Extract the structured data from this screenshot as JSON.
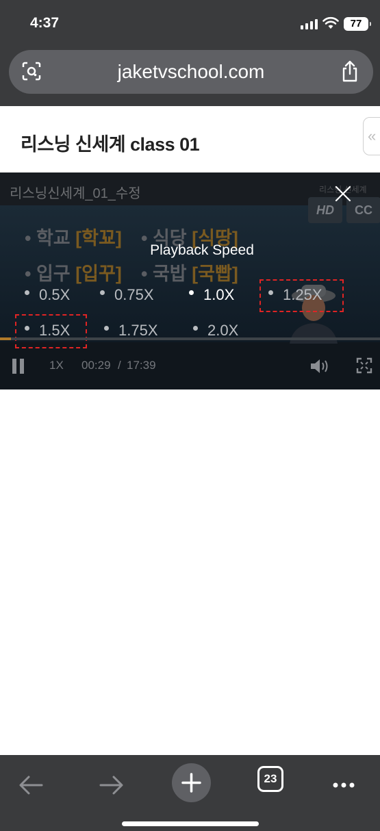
{
  "status_bar": {
    "time": "4:37",
    "battery": "77"
  },
  "browser": {
    "url": "jaketvschool.com",
    "tab_count": "23"
  },
  "page": {
    "title": "리스닝 신세계 class 01",
    "collapse_glyph": "«"
  },
  "player": {
    "video_title": "리스닝신세계_01_수정",
    "side_title": "리스닝 신세계",
    "hd_label": "HD",
    "cc_label": "CC",
    "background_words": [
      {
        "text": "학교 ",
        "highlight": "[학꾜]"
      },
      {
        "text": "식당 ",
        "highlight": "[식땅]"
      },
      {
        "text": "입구 ",
        "highlight": "[입꾸]"
      },
      {
        "text": "국밥 ",
        "highlight": "[국빱]"
      }
    ],
    "speed_menu": {
      "title": "Playback Speed",
      "options": [
        "0.5X",
        "0.75X",
        "1.0X",
        "1.25X",
        "1.5X",
        "1.75X",
        "2.0X"
      ],
      "selected": "1.0X"
    },
    "progress": 0.028,
    "controls": {
      "speed_label": "1X",
      "current_time": "00:29",
      "separator": "/",
      "duration": "17:39"
    }
  },
  "colors": {
    "chrome": "#3a3b3d",
    "marker": "#e02424",
    "progress": "#b07a2a"
  }
}
